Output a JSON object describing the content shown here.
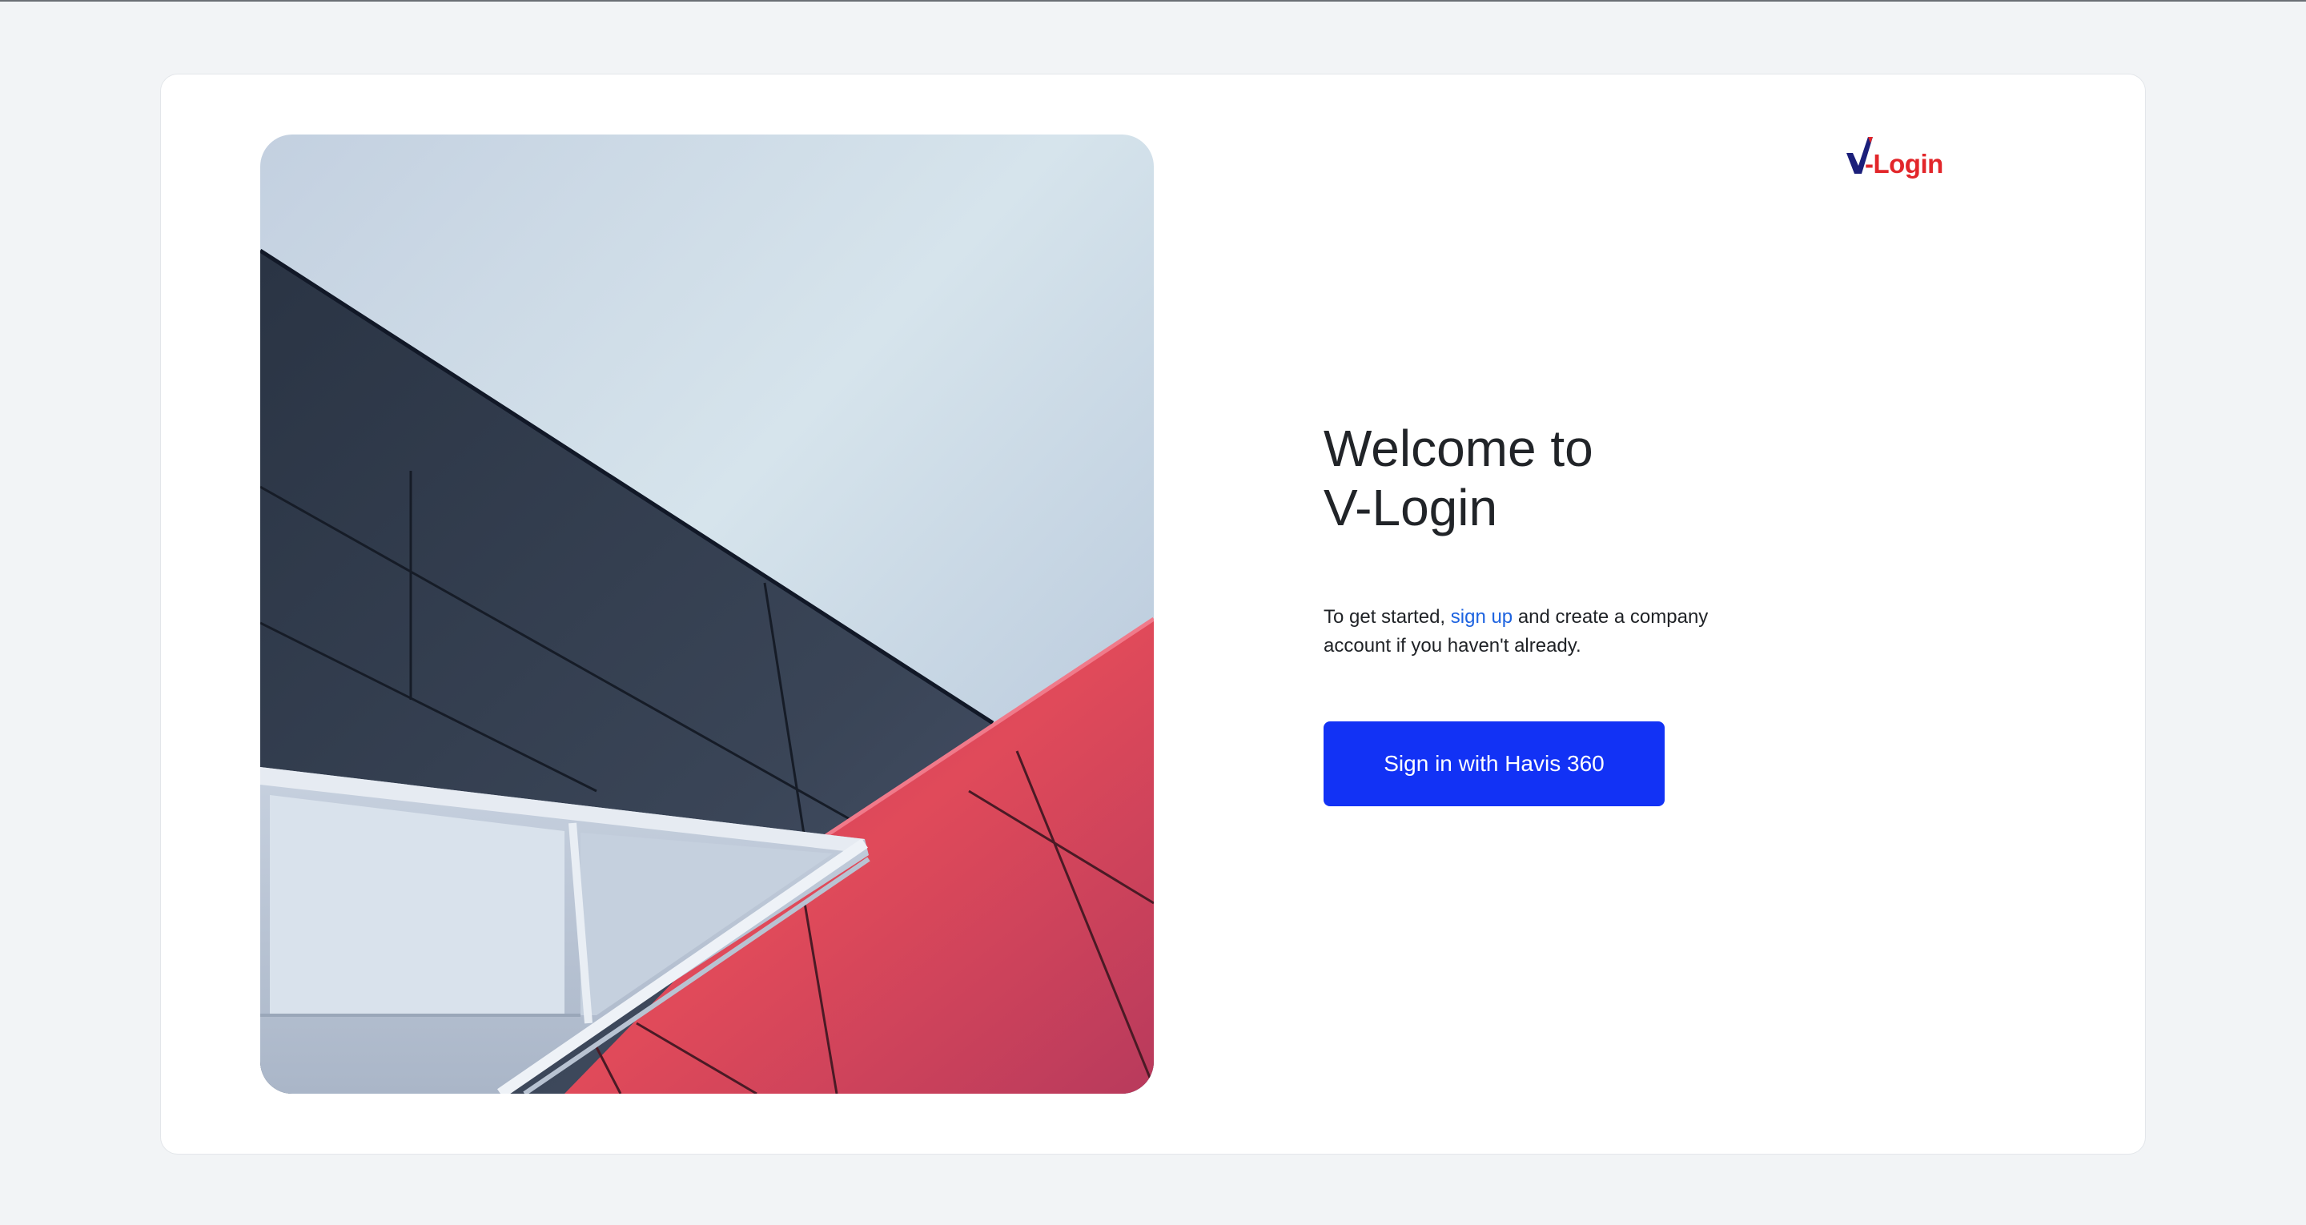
{
  "logo": {
    "text": "-Login",
    "accent_color": "#e2262a",
    "mark_color": "#1b1f7a"
  },
  "hero": {
    "image": "architecture-photo-dark-and-red-panels"
  },
  "welcome": {
    "title_line1": "Welcome to",
    "title_line2": "V-Login"
  },
  "intro": {
    "before_link": "To get started, ",
    "link_text": "sign up",
    "after_link": " and create a company account if you haven't already."
  },
  "signin": {
    "label": "Sign in with Havis 360",
    "color": "#1232f5"
  }
}
